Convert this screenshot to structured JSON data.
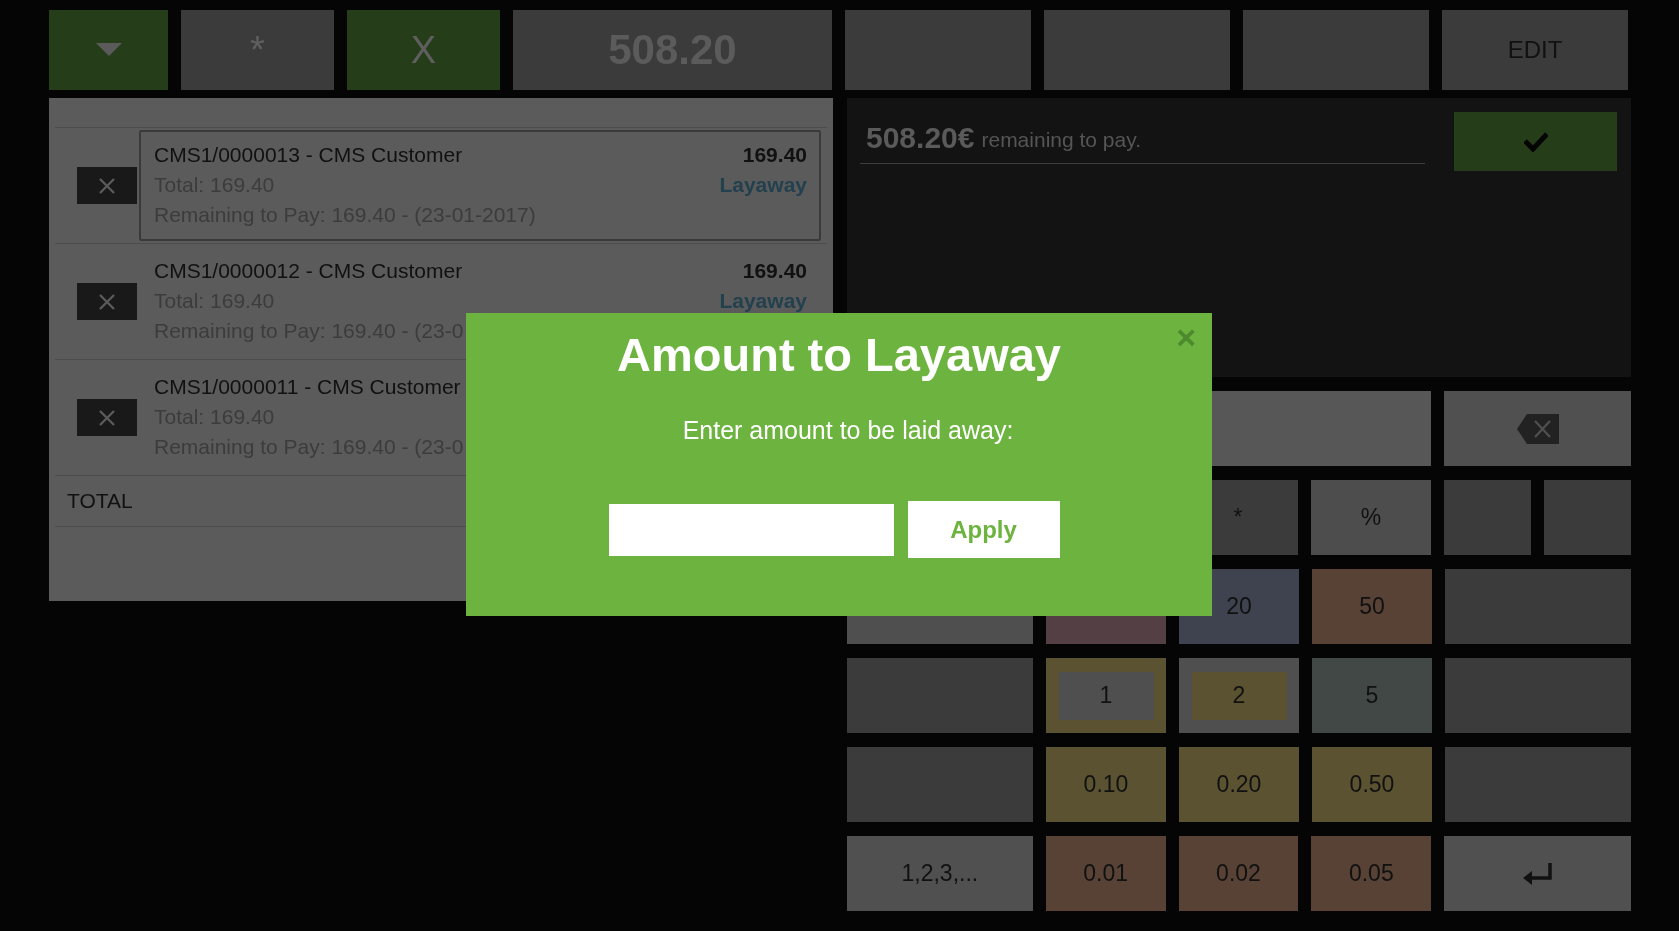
{
  "toolbar": [
    {
      "kind": "caret",
      "color": "#253d18"
    },
    {
      "kind": "small",
      "label": "*",
      "color": "#3b3b3b"
    },
    {
      "kind": "small",
      "label": "X",
      "color": "#253d18"
    },
    {
      "kind": "amount",
      "label": "508.20",
      "color": "#3b3b3b"
    },
    {
      "kind": "medium",
      "color": "#3b3b3b"
    },
    {
      "kind": "medium",
      "color": "#3b3b3b"
    },
    {
      "kind": "medium",
      "color": "#3b3b3b"
    },
    {
      "kind": "medium",
      "label": "EDIT",
      "color": "#3b3b3b"
    }
  ],
  "receipts": [
    {
      "number": "CMS1/0000013 - CMS Customer",
      "total": "Total: 169.40",
      "remaining": "Remaining to Pay: 169.40 - (23-01-2017)",
      "amount": "169.40",
      "status": "Layaway",
      "selected": true
    },
    {
      "number": "CMS1/0000012 - CMS Customer",
      "total": "Total: 169.40",
      "remaining": "Remaining to Pay: 169.40 - (23-0",
      "amount": "169.40",
      "status": "Layaway",
      "selected": false
    },
    {
      "number": "CMS1/0000011 - CMS Customer",
      "total": "Total: 169.40",
      "remaining": "Remaining to Pay: 169.40 - (23-0",
      "selected": false
    }
  ],
  "total_label": "TOTAL",
  "payment": {
    "amount": "508.20€",
    "text": "remaining to pay."
  },
  "keypad": [
    [
      {
        "kind": "wide",
        "color": "#575757"
      },
      {
        "kind": "backspace",
        "color": "#505050"
      }
    ],
    [
      {
        "kind": "normal",
        "label": "*",
        "color": "#3b3b3b"
      },
      {
        "kind": "normal",
        "label": "%",
        "color": "#4d4d4d"
      },
      {
        "kind": "half",
        "color": "#3b3b3b"
      },
      {
        "kind": "half",
        "color": "#3b3b3b"
      }
    ],
    [
      {
        "kind": "side",
        "color": "#4f4f4f"
      },
      {
        "kind": "normal",
        "color": "#544044"
      },
      {
        "kind": "normal",
        "label": "20",
        "color": "#3f4350"
      },
      {
        "kind": "normal",
        "label": "50",
        "color": "#574235"
      },
      {
        "kind": "side",
        "color": "#3b3b3b"
      }
    ],
    [
      {
        "kind": "side",
        "color": "#3b3b3b"
      },
      {
        "kind": "framed",
        "label": "1",
        "color": "#5a5230",
        "inner": {
          "color": "#4f4f4f"
        }
      },
      {
        "kind": "framed",
        "label": "2",
        "color": "#4f4f4f",
        "inner": {
          "color": "#5a5230"
        }
      },
      {
        "kind": "normal",
        "label": "5",
        "color": "#414845"
      },
      {
        "kind": "side",
        "color": "#3b3b3b"
      }
    ],
    [
      {
        "kind": "side",
        "color": "#3b3b3b"
      },
      {
        "kind": "normal",
        "label": "0.10",
        "color": "#5a5230"
      },
      {
        "kind": "normal",
        "label": "0.20",
        "color": "#5a5230"
      },
      {
        "kind": "normal",
        "label": "0.50",
        "color": "#5a5230"
      },
      {
        "kind": "side",
        "color": "#3b3b3b"
      }
    ],
    [
      {
        "kind": "side",
        "label": "1,2,3,...",
        "color": "#505050"
      },
      {
        "kind": "normal",
        "label": "0.01",
        "color": "#574235"
      },
      {
        "kind": "normal",
        "label": "0.02",
        "color": "#574235"
      },
      {
        "kind": "normal",
        "label": "0.05",
        "color": "#574235"
      },
      {
        "kind": "enter",
        "color": "#505050"
      }
    ]
  ],
  "dialog": {
    "title": "Amount to Layaway",
    "close": "×",
    "prompt": "Enter amount to be laid away:",
    "button": "Apply"
  }
}
